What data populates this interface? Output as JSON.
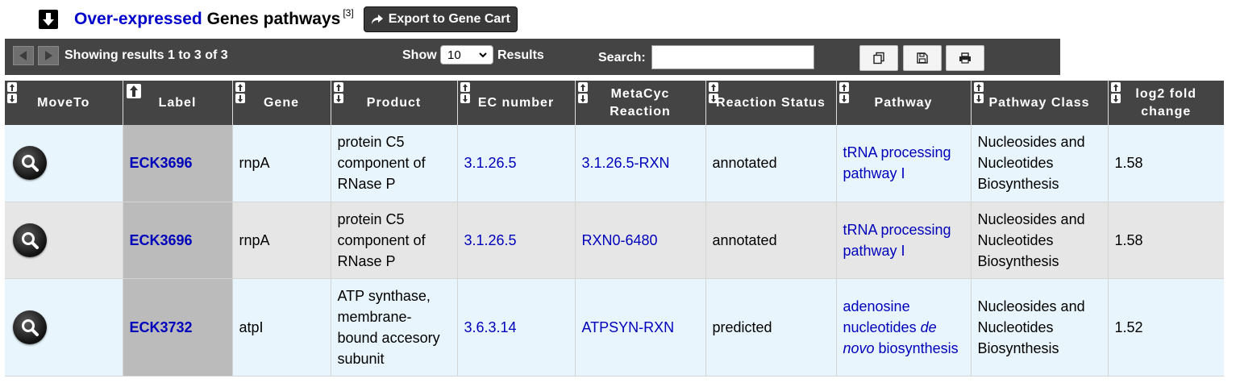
{
  "header": {
    "title_highlight": "Over-expressed",
    "title_rest": " Genes pathways",
    "footnote": "[3]",
    "export_label": "Export to Gene Cart"
  },
  "toolbar": {
    "showing_text": "Showing results 1 to 3 of 3",
    "show_label": "Show",
    "page_length": "10",
    "results_label": "Results",
    "search_label": "Search:",
    "search_value": ""
  },
  "columns": [
    {
      "label": "MoveTo"
    },
    {
      "label": "Label"
    },
    {
      "label": "Gene"
    },
    {
      "label": "Product"
    },
    {
      "label": "EC number"
    },
    {
      "label": "MetaCyc Reaction"
    },
    {
      "label": "Reaction Status"
    },
    {
      "label": "Pathway"
    },
    {
      "label": "Pathway Class"
    },
    {
      "label": "log2 fold change"
    }
  ],
  "rows": [
    {
      "label": "ECK3696",
      "gene": "rnpA",
      "product": "protein C5 component of RNase P",
      "ec": "3.1.26.5",
      "reaction": "3.1.26.5-RXN",
      "status": "annotated",
      "pathway_a": "tRNA processing pathway I",
      "pathway_italic": "",
      "pathway_b": "",
      "pathway_class": "Nucleosides and Nucleotides Biosynthesis",
      "fold": "1.58"
    },
    {
      "label": "ECK3696",
      "gene": "rnpA",
      "product": "protein C5 component of RNase P",
      "ec": "3.1.26.5",
      "reaction": "RXN0-6480",
      "status": "annotated",
      "pathway_a": "tRNA processing pathway I",
      "pathway_italic": "",
      "pathway_b": "",
      "pathway_class": "Nucleosides and Nucleotides Biosynthesis",
      "fold": "1.58"
    },
    {
      "label": "ECK3732",
      "gene": "atpI",
      "product": "ATP synthase, membrane-bound accesory subunit",
      "ec": "3.6.3.14",
      "reaction": "ATPSYN-RXN",
      "status": "predicted",
      "pathway_a": "adenosine nucleotides ",
      "pathway_italic": "de novo",
      "pathway_b": " biosynthesis",
      "pathway_class": "Nucleosides and Nucleotides Biosynthesis",
      "fold": "1.52"
    }
  ]
}
